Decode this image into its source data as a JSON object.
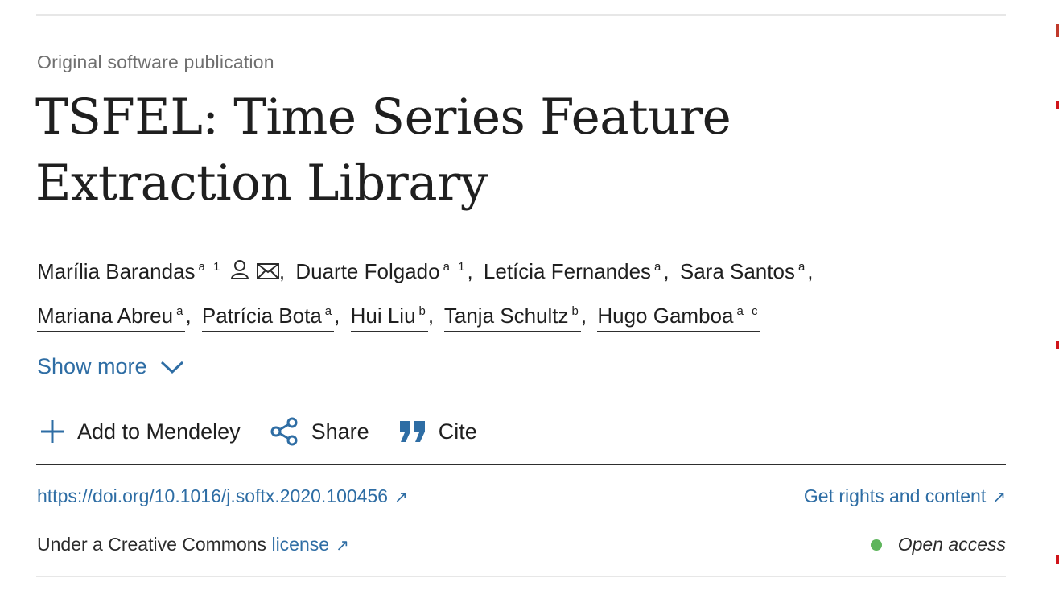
{
  "article_type": "Original software publication",
  "title": "TSFEL: Time Series Feature Extraction Library",
  "authors": [
    {
      "name": "Marília Barandas",
      "aff": "a 1",
      "icons": [
        "person-icon",
        "envelope-icon"
      ]
    },
    {
      "name": "Duarte Folgado",
      "aff": "a 1"
    },
    {
      "name": "Letícia Fernandes",
      "aff": "a"
    },
    {
      "name": "Sara Santos",
      "aff": "a"
    },
    {
      "name": "Mariana Abreu",
      "aff": "a"
    },
    {
      "name": "Patrícia Bota",
      "aff": "a"
    },
    {
      "name": "Hui Liu",
      "aff": "b"
    },
    {
      "name": "Tanja Schultz",
      "aff": "b"
    },
    {
      "name": "Hugo Gamboa",
      "aff": "a c"
    }
  ],
  "separator": ",",
  "show_more": "Show more",
  "toolbar": {
    "add_label": "Add to Mendeley",
    "share_label": "Share",
    "cite_label": "Cite"
  },
  "doi": "https://doi.org/10.1016/j.softx.2020.100456",
  "rights": "Get rights and content",
  "license": {
    "prefix": "Under a Creative Commons",
    "link": "license"
  },
  "open_access": "Open access",
  "colors": {
    "link": "#2e6da4",
    "text": "#1f1f1f",
    "open_access_dot": "#5eb55c"
  },
  "icons": {
    "external": "↗"
  }
}
